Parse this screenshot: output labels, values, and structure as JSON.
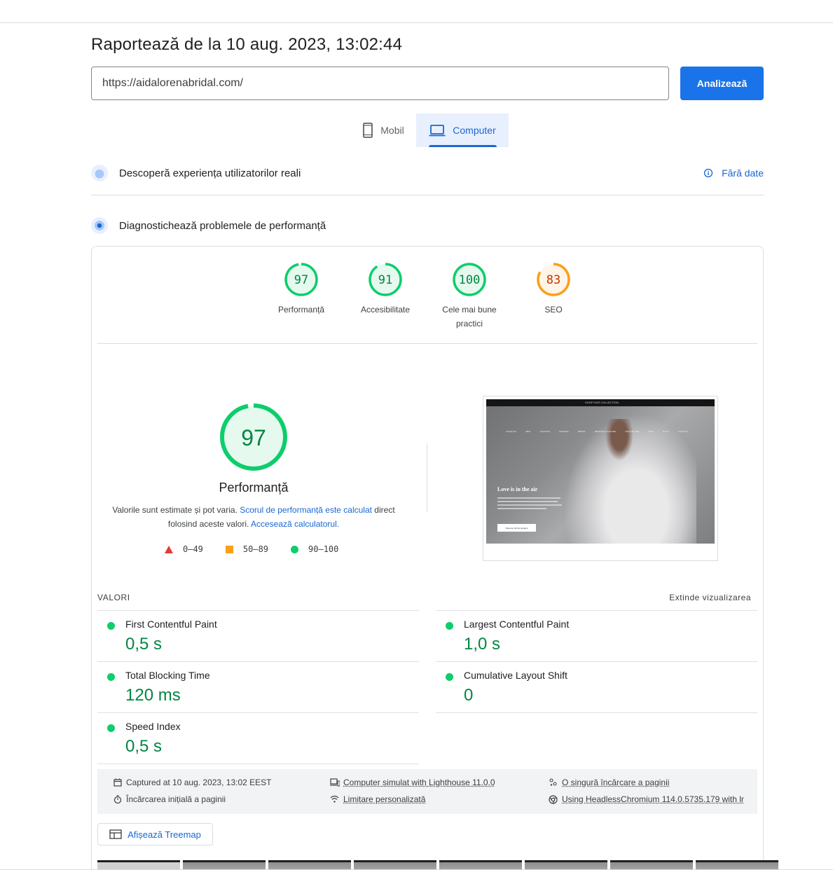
{
  "report": {
    "title": "Raportează de la 10 aug. 2023, 13:02:44"
  },
  "search": {
    "url": "https://aidalorenabridal.com/",
    "analyze_label": "Analizează"
  },
  "tabs": {
    "mobile": "Mobil",
    "computer": "Computer",
    "active": "computer"
  },
  "crux": {
    "title": "Descoperă experiența utilizatorilor reali",
    "status": "Fără date"
  },
  "diagnose": {
    "title": "Diagnostichează problemele de performanță"
  },
  "categories": [
    {
      "score": "97",
      "label": "Performanță",
      "fraction": 0.97,
      "color": "#0cce6b",
      "text_color": "#018642",
      "bg": "#e6f9ef"
    },
    {
      "score": "91",
      "label": "Accesibilitate",
      "fraction": 0.91,
      "color": "#0cce6b",
      "text_color": "#018642",
      "bg": "#e6f9ef"
    },
    {
      "score": "100",
      "label": "Cele mai bune practici",
      "fraction": 1.0,
      "color": "#0cce6b",
      "text_color": "#018642",
      "bg": "#e6f9ef"
    },
    {
      "score": "83",
      "label": "SEO",
      "fraction": 0.83,
      "color": "#fa9f1a",
      "text_color": "#c33300",
      "bg": "#fff5e6"
    }
  ],
  "performance": {
    "score": "97",
    "fraction": 0.97,
    "title": "Performanță",
    "desc_prefix": "Valorile sunt estimate și pot varia. ",
    "desc_link1": "Scorul de performanță este calculat",
    "desc_middle": " direct folosind aceste valori. ",
    "desc_link2": "Accesează calculatorul.",
    "legend": {
      "low": "0–49",
      "mid": "50–89",
      "high": "90–100"
    }
  },
  "screenshot": {
    "promo": "SHOP OUR COLLECTION",
    "nav": [
      "COLECȚIA",
      "NEW",
      "COCKTAIL",
      "EVENING",
      "BRIDAL",
      "BESPOKE COUTURE",
      "WHO WE ARE",
      "SALE",
      "BLOG",
      "CONTACT"
    ],
    "headline": "Love is in the air",
    "button": "Discover all the designs"
  },
  "metrics": {
    "label": "VALORI",
    "expand": "Extinde vizualizarea",
    "items": [
      {
        "name": "First Contentful Paint",
        "value": "0,5 s"
      },
      {
        "name": "Largest Contentful Paint",
        "value": "1,0 s"
      },
      {
        "name": "Total Blocking Time",
        "value": "120 ms"
      },
      {
        "name": "Cumulative Layout Shift",
        "value": "0"
      },
      {
        "name": "Speed Index",
        "value": "0,5 s"
      }
    ]
  },
  "runtime": {
    "captured": "Captured at 10 aug. 2023, 13:02 EEST",
    "initial_load": "Încărcarea inițială a paginii",
    "device": "Computer simulat with Lighthouse 11.0.0",
    "throttling": "Limitare personalizată",
    "single_load": "O singură încărcare a paginii",
    "browser": "Using HeadlessChromium 114.0.5735.179 with lr"
  },
  "treemap": {
    "label": "Afișează Treemap"
  }
}
